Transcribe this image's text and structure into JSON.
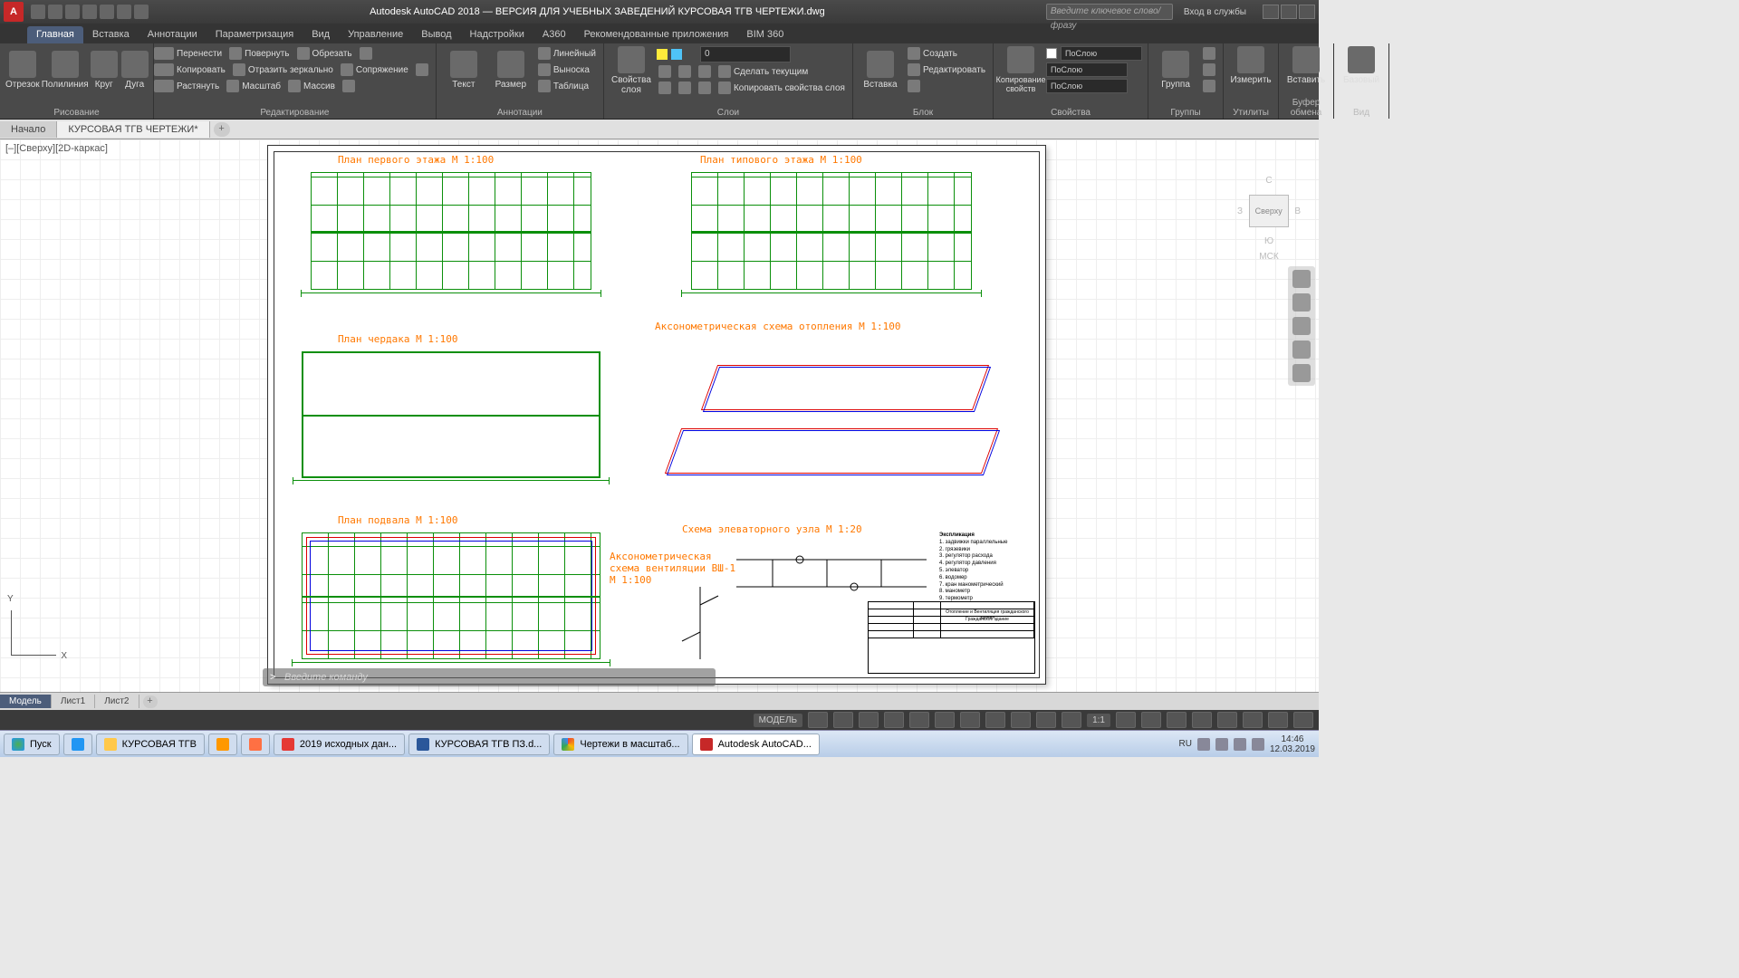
{
  "titlebar": {
    "app_letter": "A",
    "title": "Autodesk AutoCAD 2018 — ВЕРСИЯ ДЛЯ УЧЕБНЫХ ЗАВЕДЕНИЙ   КУРСОВАЯ ТГВ ЧЕРТЕЖИ.dwg",
    "search_placeholder": "Введите ключевое слово/фразу",
    "signin": "Вход в службы"
  },
  "menu_tabs": [
    "Главная",
    "Вставка",
    "Аннотации",
    "Параметризация",
    "Вид",
    "Управление",
    "Вывод",
    "Надстройки",
    "A360",
    "Рекомендованные приложения",
    "BIM 360"
  ],
  "active_menu": 0,
  "ribbon": {
    "draw": {
      "name": "Рисование",
      "btns": [
        "Отрезок",
        "Полилиния",
        "Круг",
        "Дуга"
      ]
    },
    "modify": {
      "name": "Редактирование",
      "items": [
        "Перенести",
        "Повернуть",
        "Обрезать",
        "Копировать",
        "Отразить зеркально",
        "Сопряжение",
        "Растянуть",
        "Масштаб",
        "Массив"
      ]
    },
    "annot": {
      "name": "Аннотации",
      "btns": [
        "Текст",
        "Размер"
      ],
      "items": [
        "Линейный",
        "Выноска",
        "Таблица"
      ]
    },
    "layers": {
      "name": "Слои",
      "btn": "Свойства слоя",
      "combo": "0",
      "items": [
        "Сделать текущим",
        "Копировать свойства слоя"
      ]
    },
    "block": {
      "name": "Блок",
      "btn": "Вставка",
      "items": [
        "Создать",
        "Редактировать"
      ]
    },
    "match": {
      "name": "Свойства",
      "btn": "Копирование свойств",
      "combos": [
        "ПоСлою",
        "ПоСлою",
        "ПоСлою"
      ]
    },
    "groups": {
      "name": "Группы",
      "btn": "Группа"
    },
    "utils": {
      "name": "Утилиты",
      "btn": "Измерить"
    },
    "clip": {
      "name": "Буфер обмена",
      "btn": "Вставить"
    },
    "view": {
      "name": "Вид",
      "btn": "Базовый"
    }
  },
  "file_tabs": {
    "start": "Начало",
    "file": "КУРСОВАЯ ТГВ ЧЕРТЕЖИ*"
  },
  "viewport_label": "[–][Сверху][2D-каркас]",
  "cmd_placeholder": "Введите команду",
  "drawings": {
    "t1": "План первого этажа М 1:100",
    "t2": "План типового этажа М 1:100",
    "t3": "План чердака М 1:100",
    "t4": "Аксонометрическая схема      отопления М 1:100",
    "t5": "План подвала М 1:100",
    "t6": "Схема элеваторного узла М 1:20",
    "t7": "Аксонометрическая схема вентиляции ВШ-1 М 1:100"
  },
  "explication": {
    "title": "Экспликация",
    "items": [
      "1. задвижки параллельные",
      "2. грязевики",
      "3. регулятор расхода",
      "4. регулятор давления",
      "5. элеватор",
      "6. водомер",
      "7. кран манометрический",
      "8. манометр",
      "9. термометр"
    ]
  },
  "viewcube": {
    "face": "Сверху",
    "n": "С",
    "e": "В",
    "s": "Ю",
    "w": "З",
    "wcs": "МСК"
  },
  "model_tabs": [
    "Модель",
    "Лист1",
    "Лист2"
  ],
  "status": {
    "model": "МОДЕЛЬ",
    "scale": "1:1"
  },
  "taskbar": {
    "start": "Пуск",
    "items": [
      "КУРСОВАЯ ТГВ",
      "",
      "",
      "2019 исходных дан...",
      "",
      "КУРСОВАЯ ТГВ ПЗ.d...",
      "Чертежи в масштаб...",
      "Autodesk AutoCAD..."
    ],
    "lang": "RU",
    "time": "14:46",
    "date": "12.03.2019"
  }
}
